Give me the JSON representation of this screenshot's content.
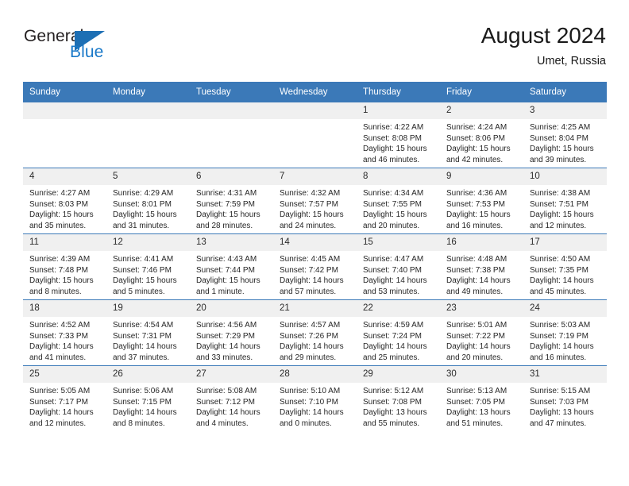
{
  "brand": {
    "word_one": "General",
    "word_two": "Blue",
    "triangle_icon": "triangle-icon",
    "color_dark": "#231f20",
    "color_blue": "#1878c8"
  },
  "header": {
    "title": "August 2024",
    "subtitle": "Umet, Russia"
  },
  "theme": {
    "header_blue": "#3b79b8",
    "daynum_gray": "#f0f0f0",
    "text": "#262626"
  },
  "calendar": {
    "weekday_headers": [
      "Sunday",
      "Monday",
      "Tuesday",
      "Wednesday",
      "Thursday",
      "Friday",
      "Saturday"
    ],
    "weeks": [
      [
        {
          "day": "",
          "sunrise": "",
          "sunset": "",
          "daylight_line1": "",
          "daylight_line2": ""
        },
        {
          "day": "",
          "sunrise": "",
          "sunset": "",
          "daylight_line1": "",
          "daylight_line2": ""
        },
        {
          "day": "",
          "sunrise": "",
          "sunset": "",
          "daylight_line1": "",
          "daylight_line2": ""
        },
        {
          "day": "",
          "sunrise": "",
          "sunset": "",
          "daylight_line1": "",
          "daylight_line2": ""
        },
        {
          "day": "1",
          "sunrise": "Sunrise: 4:22 AM",
          "sunset": "Sunset: 8:08 PM",
          "daylight_line1": "Daylight: 15 hours",
          "daylight_line2": "and 46 minutes."
        },
        {
          "day": "2",
          "sunrise": "Sunrise: 4:24 AM",
          "sunset": "Sunset: 8:06 PM",
          "daylight_line1": "Daylight: 15 hours",
          "daylight_line2": "and 42 minutes."
        },
        {
          "day": "3",
          "sunrise": "Sunrise: 4:25 AM",
          "sunset": "Sunset: 8:04 PM",
          "daylight_line1": "Daylight: 15 hours",
          "daylight_line2": "and 39 minutes."
        }
      ],
      [
        {
          "day": "4",
          "sunrise": "Sunrise: 4:27 AM",
          "sunset": "Sunset: 8:03 PM",
          "daylight_line1": "Daylight: 15 hours",
          "daylight_line2": "and 35 minutes."
        },
        {
          "day": "5",
          "sunrise": "Sunrise: 4:29 AM",
          "sunset": "Sunset: 8:01 PM",
          "daylight_line1": "Daylight: 15 hours",
          "daylight_line2": "and 31 minutes."
        },
        {
          "day": "6",
          "sunrise": "Sunrise: 4:31 AM",
          "sunset": "Sunset: 7:59 PM",
          "daylight_line1": "Daylight: 15 hours",
          "daylight_line2": "and 28 minutes."
        },
        {
          "day": "7",
          "sunrise": "Sunrise: 4:32 AM",
          "sunset": "Sunset: 7:57 PM",
          "daylight_line1": "Daylight: 15 hours",
          "daylight_line2": "and 24 minutes."
        },
        {
          "day": "8",
          "sunrise": "Sunrise: 4:34 AM",
          "sunset": "Sunset: 7:55 PM",
          "daylight_line1": "Daylight: 15 hours",
          "daylight_line2": "and 20 minutes."
        },
        {
          "day": "9",
          "sunrise": "Sunrise: 4:36 AM",
          "sunset": "Sunset: 7:53 PM",
          "daylight_line1": "Daylight: 15 hours",
          "daylight_line2": "and 16 minutes."
        },
        {
          "day": "10",
          "sunrise": "Sunrise: 4:38 AM",
          "sunset": "Sunset: 7:51 PM",
          "daylight_line1": "Daylight: 15 hours",
          "daylight_line2": "and 12 minutes."
        }
      ],
      [
        {
          "day": "11",
          "sunrise": "Sunrise: 4:39 AM",
          "sunset": "Sunset: 7:48 PM",
          "daylight_line1": "Daylight: 15 hours",
          "daylight_line2": "and 8 minutes."
        },
        {
          "day": "12",
          "sunrise": "Sunrise: 4:41 AM",
          "sunset": "Sunset: 7:46 PM",
          "daylight_line1": "Daylight: 15 hours",
          "daylight_line2": "and 5 minutes."
        },
        {
          "day": "13",
          "sunrise": "Sunrise: 4:43 AM",
          "sunset": "Sunset: 7:44 PM",
          "daylight_line1": "Daylight: 15 hours",
          "daylight_line2": "and 1 minute."
        },
        {
          "day": "14",
          "sunrise": "Sunrise: 4:45 AM",
          "sunset": "Sunset: 7:42 PM",
          "daylight_line1": "Daylight: 14 hours",
          "daylight_line2": "and 57 minutes."
        },
        {
          "day": "15",
          "sunrise": "Sunrise: 4:47 AM",
          "sunset": "Sunset: 7:40 PM",
          "daylight_line1": "Daylight: 14 hours",
          "daylight_line2": "and 53 minutes."
        },
        {
          "day": "16",
          "sunrise": "Sunrise: 4:48 AM",
          "sunset": "Sunset: 7:38 PM",
          "daylight_line1": "Daylight: 14 hours",
          "daylight_line2": "and 49 minutes."
        },
        {
          "day": "17",
          "sunrise": "Sunrise: 4:50 AM",
          "sunset": "Sunset: 7:35 PM",
          "daylight_line1": "Daylight: 14 hours",
          "daylight_line2": "and 45 minutes."
        }
      ],
      [
        {
          "day": "18",
          "sunrise": "Sunrise: 4:52 AM",
          "sunset": "Sunset: 7:33 PM",
          "daylight_line1": "Daylight: 14 hours",
          "daylight_line2": "and 41 minutes."
        },
        {
          "day": "19",
          "sunrise": "Sunrise: 4:54 AM",
          "sunset": "Sunset: 7:31 PM",
          "daylight_line1": "Daylight: 14 hours",
          "daylight_line2": "and 37 minutes."
        },
        {
          "day": "20",
          "sunrise": "Sunrise: 4:56 AM",
          "sunset": "Sunset: 7:29 PM",
          "daylight_line1": "Daylight: 14 hours",
          "daylight_line2": "and 33 minutes."
        },
        {
          "day": "21",
          "sunrise": "Sunrise: 4:57 AM",
          "sunset": "Sunset: 7:26 PM",
          "daylight_line1": "Daylight: 14 hours",
          "daylight_line2": "and 29 minutes."
        },
        {
          "day": "22",
          "sunrise": "Sunrise: 4:59 AM",
          "sunset": "Sunset: 7:24 PM",
          "daylight_line1": "Daylight: 14 hours",
          "daylight_line2": "and 25 minutes."
        },
        {
          "day": "23",
          "sunrise": "Sunrise: 5:01 AM",
          "sunset": "Sunset: 7:22 PM",
          "daylight_line1": "Daylight: 14 hours",
          "daylight_line2": "and 20 minutes."
        },
        {
          "day": "24",
          "sunrise": "Sunrise: 5:03 AM",
          "sunset": "Sunset: 7:19 PM",
          "daylight_line1": "Daylight: 14 hours",
          "daylight_line2": "and 16 minutes."
        }
      ],
      [
        {
          "day": "25",
          "sunrise": "Sunrise: 5:05 AM",
          "sunset": "Sunset: 7:17 PM",
          "daylight_line1": "Daylight: 14 hours",
          "daylight_line2": "and 12 minutes."
        },
        {
          "day": "26",
          "sunrise": "Sunrise: 5:06 AM",
          "sunset": "Sunset: 7:15 PM",
          "daylight_line1": "Daylight: 14 hours",
          "daylight_line2": "and 8 minutes."
        },
        {
          "day": "27",
          "sunrise": "Sunrise: 5:08 AM",
          "sunset": "Sunset: 7:12 PM",
          "daylight_line1": "Daylight: 14 hours",
          "daylight_line2": "and 4 minutes."
        },
        {
          "day": "28",
          "sunrise": "Sunrise: 5:10 AM",
          "sunset": "Sunset: 7:10 PM",
          "daylight_line1": "Daylight: 14 hours",
          "daylight_line2": "and 0 minutes."
        },
        {
          "day": "29",
          "sunrise": "Sunrise: 5:12 AM",
          "sunset": "Sunset: 7:08 PM",
          "daylight_line1": "Daylight: 13 hours",
          "daylight_line2": "and 55 minutes."
        },
        {
          "day": "30",
          "sunrise": "Sunrise: 5:13 AM",
          "sunset": "Sunset: 7:05 PM",
          "daylight_line1": "Daylight: 13 hours",
          "daylight_line2": "and 51 minutes."
        },
        {
          "day": "31",
          "sunrise": "Sunrise: 5:15 AM",
          "sunset": "Sunset: 7:03 PM",
          "daylight_line1": "Daylight: 13 hours",
          "daylight_line2": "and 47 minutes."
        }
      ]
    ]
  }
}
